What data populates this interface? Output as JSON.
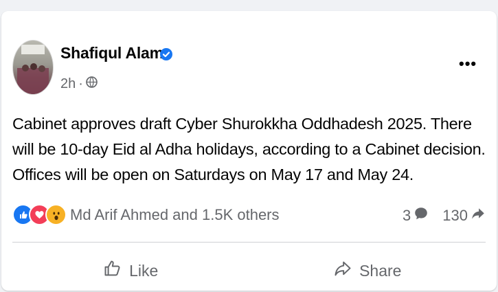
{
  "post": {
    "author": "Shafiqul Alam",
    "time": "2h",
    "separator": "·",
    "text": "Cabinet approves draft Cyber Shurokkha Oddhadesh 2025. There will be 10-day Eid al Adha holidays, according to a Cabinet decision. Offices will be open on Saturdays on May 17 and May 24.",
    "more_label": "•••"
  },
  "reactions": {
    "icons": [
      "like-icon",
      "love-icon",
      "wow-icon"
    ],
    "summary": "Md Arif Ahmed and 1.5K others",
    "comments": "3",
    "shares": "130"
  },
  "actions": {
    "like": "Like",
    "share": "Share"
  },
  "colors": {
    "like_blue": "#1877f2",
    "love_red": "#f33e58",
    "wow_yellow": "#f7b125",
    "verified_blue": "#1877f2",
    "secondary_text": "#65676b"
  }
}
